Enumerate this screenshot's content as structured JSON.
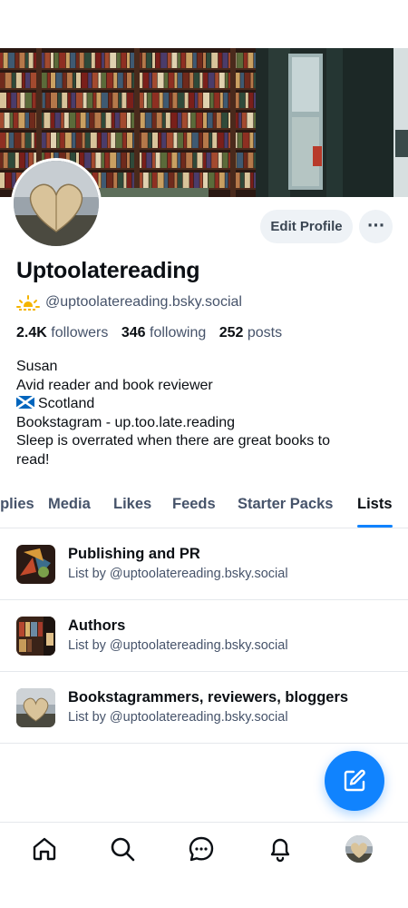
{
  "profile": {
    "display_name": "Uptoolatereading",
    "handle": "@uptoolatereading.bsky.social",
    "handle_icon": "sunrise-emoji",
    "edit_label": "Edit Profile",
    "more_label": "···",
    "stats": {
      "followers_count": "2.4K",
      "followers_label": "followers",
      "following_count": "346",
      "following_label": "following",
      "posts_count": "252",
      "posts_label": "posts"
    },
    "bio": {
      "line1": "Susan",
      "line2": "Avid reader and book reviewer",
      "line3_flag": "scotland-flag",
      "line3": "Scotland",
      "line4": "Bookstagram - up.too.late.reading",
      "line5": "Sleep is overrated when there are great books to",
      "line6": "read!"
    }
  },
  "tabs": [
    {
      "label": "Replies",
      "active": false
    },
    {
      "label": "Media",
      "active": false
    },
    {
      "label": "Likes",
      "active": false
    },
    {
      "label": "Feeds",
      "active": false
    },
    {
      "label": "Starter Packs",
      "active": false
    },
    {
      "label": "Lists",
      "active": true
    }
  ],
  "lists": [
    {
      "title": "Publishing and PR",
      "subtitle": "List by @uptoolatereading.bsky.social"
    },
    {
      "title": "Authors",
      "subtitle": "List by @uptoolatereading.bsky.social"
    },
    {
      "title": "Bookstagrammers, reviewers, bloggers",
      "subtitle": "List by @uptoolatereading.bsky.social"
    }
  ],
  "nav": [
    "home-icon",
    "search-icon",
    "chat-icon",
    "bell-icon",
    "profile-avatar"
  ],
  "colors": {
    "accent": "#1083fe",
    "muted_text": "#46536a",
    "text": "#0b0f14",
    "pill_bg": "#eef2f6"
  }
}
